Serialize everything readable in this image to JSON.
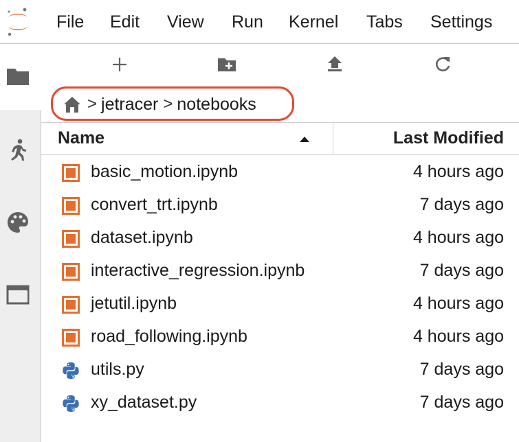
{
  "menu": {
    "items": [
      "File",
      "Edit",
      "View",
      "Run",
      "Kernel",
      "Tabs",
      "Settings"
    ]
  },
  "colors": {
    "accent_orange": "#e46e2e",
    "highlight_red": "#e24a32",
    "python_blue": "#3a6fb5"
  },
  "activity_bar": {
    "icons": [
      "folder-icon",
      "running-icon",
      "palette-icon",
      "tabs-icon"
    ]
  },
  "toolbar": {
    "icons": [
      "new-launcher-icon",
      "new-folder-icon",
      "upload-icon",
      "refresh-icon"
    ]
  },
  "breadcrumb": {
    "home_icon": "home-icon",
    "separator": ">",
    "segments": [
      "jetracer",
      "notebooks"
    ]
  },
  "file_list": {
    "columns": {
      "name": "Name",
      "modified": "Last Modified"
    },
    "sort": {
      "column": "Name",
      "direction": "ascending"
    },
    "files": [
      {
        "name": "basic_motion.ipynb",
        "modified": "4 hours ago",
        "icon": "notebook-icon"
      },
      {
        "name": "convert_trt.ipynb",
        "modified": "7 days ago",
        "icon": "notebook-icon"
      },
      {
        "name": "dataset.ipynb",
        "modified": "4 hours ago",
        "icon": "notebook-icon"
      },
      {
        "name": "interactive_regression.ipynb",
        "modified": "7 days ago",
        "icon": "notebook-icon"
      },
      {
        "name": "jetutil.ipynb",
        "modified": "4 hours ago",
        "icon": "notebook-icon"
      },
      {
        "name": "road_following.ipynb",
        "modified": "4 hours ago",
        "icon": "notebook-icon"
      },
      {
        "name": "utils.py",
        "modified": "7 days ago",
        "icon": "python-file-icon"
      },
      {
        "name": "xy_dataset.py",
        "modified": "7 days ago",
        "icon": "python-file-icon"
      }
    ]
  }
}
